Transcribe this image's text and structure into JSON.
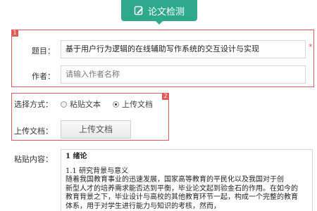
{
  "header": {
    "title": "论文检测",
    "icon": "edit-icon",
    "color": "#2fa98c"
  },
  "section1": {
    "number": "1",
    "title_label": "题目：",
    "title_value": "基于用户行为逻辑的在线辅助写作系统的交互设计与实现",
    "required_mark": "*",
    "author_label": "作者：",
    "author_placeholder": "请输入作者名称"
  },
  "section2": {
    "number": "2",
    "method_label": "选择方式：",
    "options": [
      {
        "label": "粘贴文本",
        "selected": false
      },
      {
        "label": "上传文档",
        "selected": true
      }
    ],
    "upload_label": "上传文档：",
    "upload_button": "上传文档"
  },
  "paste": {
    "label": "粘贴内容：",
    "lines": [
      "1 绪论",
      "",
      "1.1 研究背景与意义",
      "    随着我国教育事业的迅速发展，国家高等教育的平民化以及我国对于创",
      "新型人才的培养需求能否达到平衡，毕业论文起到验金石的作用。在如今的",
      "教育背景之下，毕业设计与高校的其他教育环节一起，构成一个完整的教育",
      "体系，用于对学生进行能力与知识的考核，然而，"
    ]
  },
  "colors": {
    "accent": "#2fa98c",
    "highlight": "#e25a5a"
  }
}
